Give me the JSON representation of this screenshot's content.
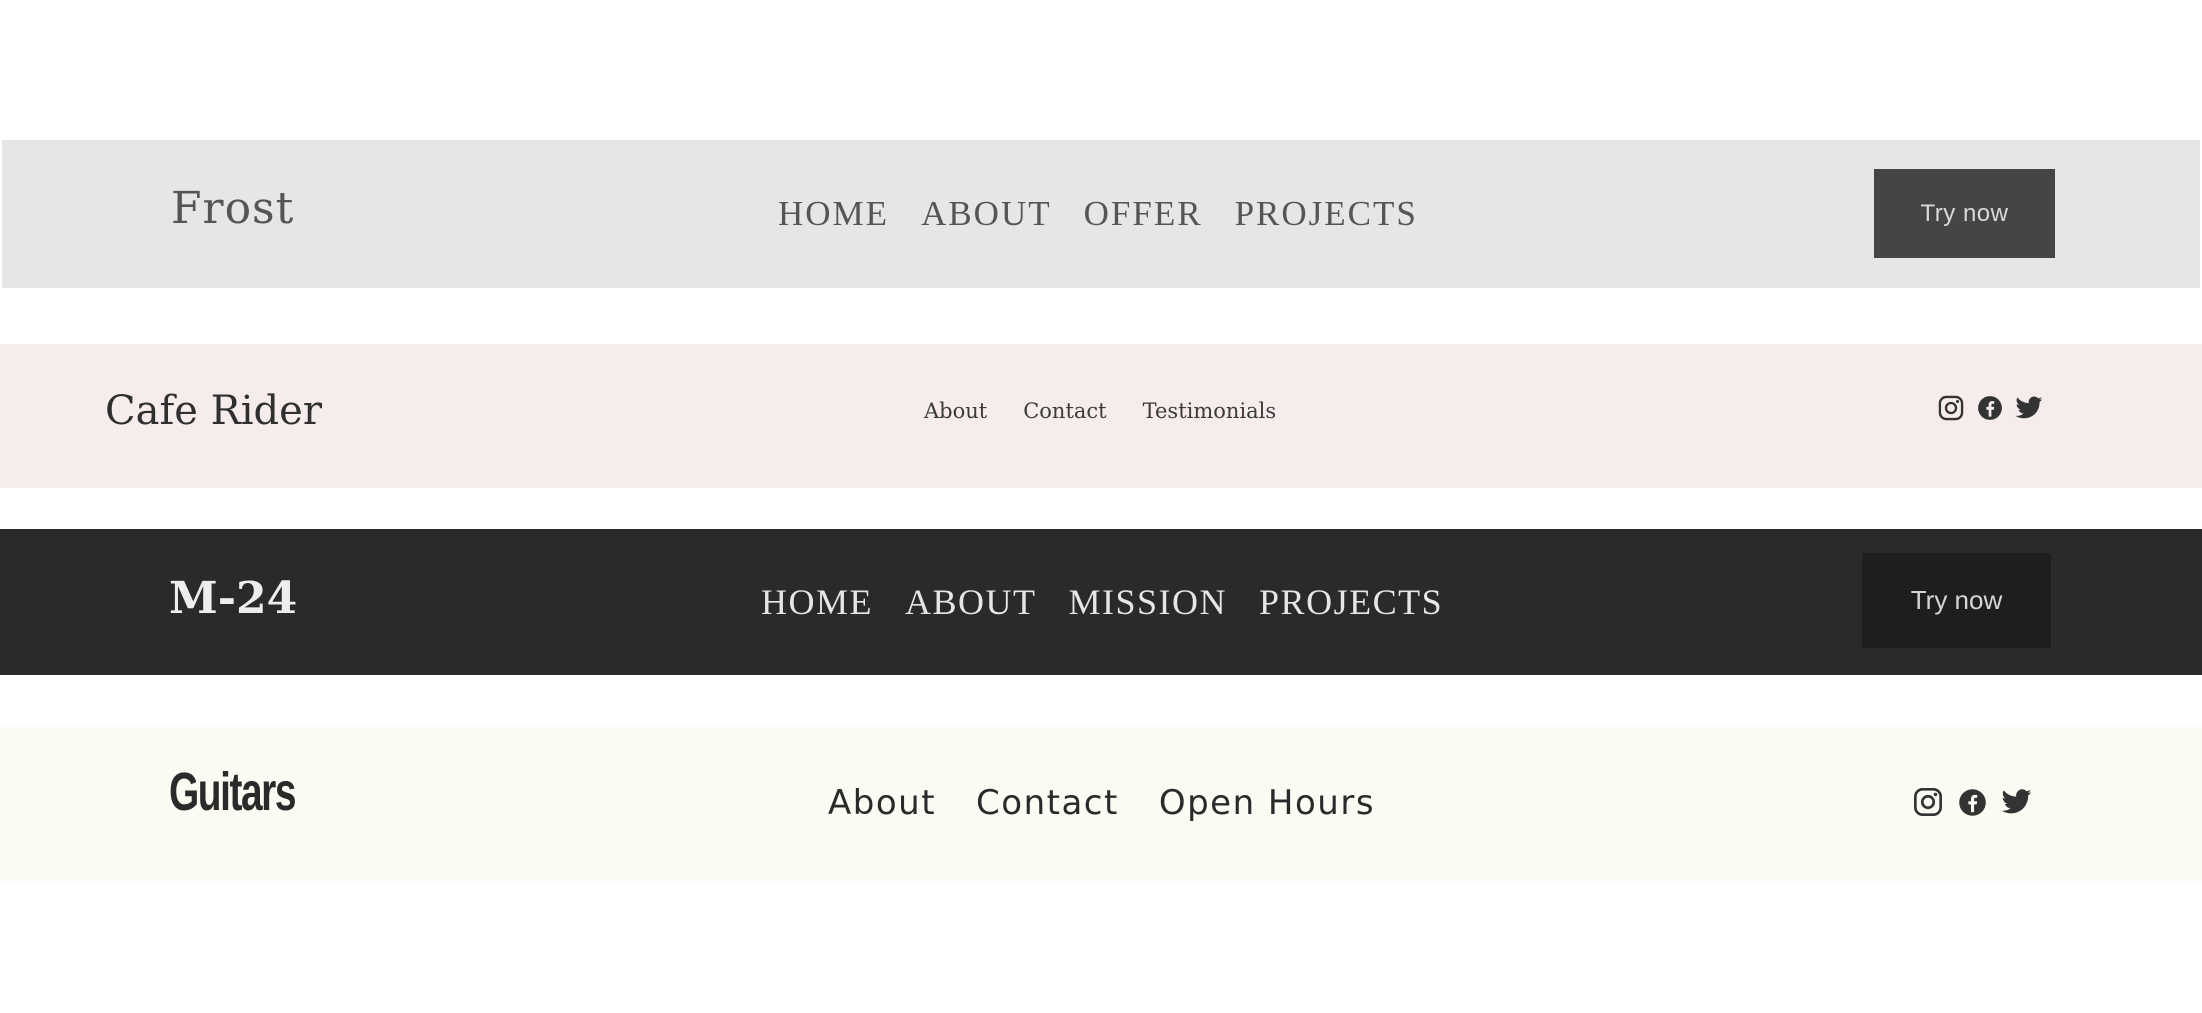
{
  "headers": [
    {
      "logo": "Frost",
      "nav": [
        "HOME",
        "ABOUT",
        "OFFER",
        "PROJECTS"
      ],
      "cta_label": "Try now",
      "background": "#e6e6e6"
    },
    {
      "logo": "Cafe Rider",
      "nav": [
        "About",
        "Contact",
        "Testimonials"
      ],
      "social_icons": [
        "instagram-icon",
        "facebook-icon",
        "twitter-icon"
      ],
      "background": "#f6ecec"
    },
    {
      "logo": "M-24",
      "nav": [
        "HOME",
        "ABOUT",
        "MISSION",
        "PROJECTS"
      ],
      "cta_label": "Try now",
      "background": "#2b2a29"
    },
    {
      "logo": "Guitars",
      "nav": [
        "About",
        "Contact",
        "Open Hours"
      ],
      "social_icons": [
        "instagram-icon",
        "facebook-icon",
        "twitter-icon"
      ],
      "background": "#fbfbf4"
    }
  ]
}
